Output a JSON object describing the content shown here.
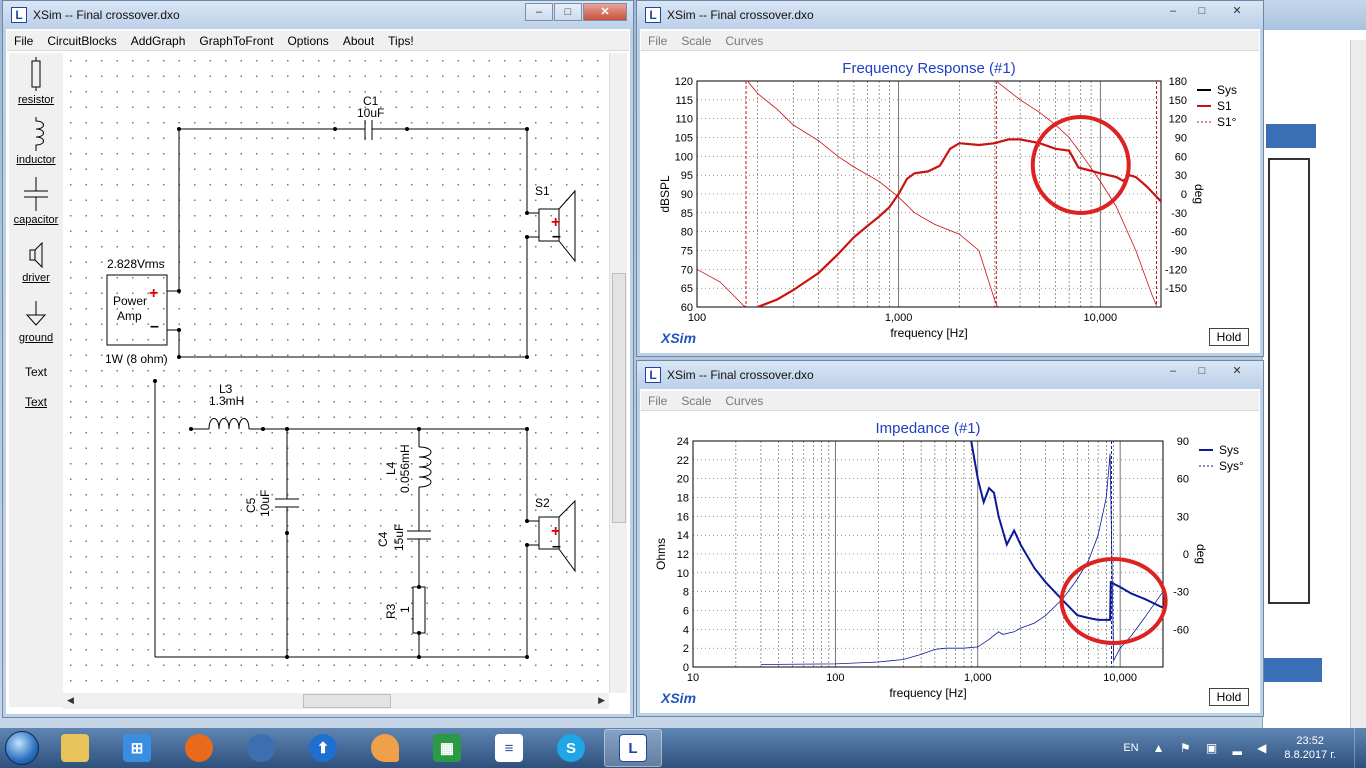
{
  "colors": {
    "sys": "#000000",
    "s1": "#cc1111",
    "imp": "#0a1a99",
    "title_blue": "#1f3fbf",
    "annot": "#dd2222"
  },
  "circuit_window": {
    "title": "XSim -- Final crossover.dxo",
    "menu": [
      "File",
      "CircuitBlocks",
      "AddGraph",
      "GraphToFront",
      "Options",
      "About",
      "Tips!"
    ],
    "palette": [
      "resistor",
      "inductor",
      "capacitor",
      "driver",
      "ground",
      "Text",
      "Text"
    ],
    "labels": {
      "c1_name": "C1",
      "c1_val": "10uF",
      "s1": "S1",
      "s2": "S2",
      "amp_v": "2.828Vrms",
      "amp_name1": "Power",
      "amp_name2": "Amp",
      "amp_p": "1W (8 ohm)",
      "l3_name": "L3",
      "l3_val": "1.3mH",
      "c5_name": "C5",
      "c5_val": "10uF",
      "l4_name": "L4",
      "l4_val": "0.056mH",
      "c4_name": "C4",
      "c4_val": "15uF",
      "r3_name": "R3",
      "r3_val": "1"
    }
  },
  "freq_window": {
    "title": "XSim -- Final crossover.dxo",
    "menu": [
      "File",
      "Scale",
      "Curves"
    ],
    "hold": "Hold",
    "logo": "XSim"
  },
  "imp_window": {
    "title": "XSim -- Final crossover.dxo",
    "menu": [
      "File",
      "Scale",
      "Curves"
    ],
    "hold": "Hold",
    "logo": "XSim"
  },
  "chart_data": [
    {
      "type": "line",
      "title": "Frequency Response (#1)",
      "xlabel": "frequency [Hz]",
      "ylabel": "dBSPL",
      "y2label": "deg",
      "x_scale": "log",
      "xlim": [
        100,
        20000
      ],
      "ylim": [
        60,
        120
      ],
      "y2lim": [
        -180,
        180
      ],
      "xticks": [
        "100",
        "1,000",
        "10,000"
      ],
      "yticks": [
        "60",
        "65",
        "70",
        "75",
        "80",
        "85",
        "90",
        "95",
        "100",
        "105",
        "110",
        "115",
        "120"
      ],
      "y2ticks": [
        "-150",
        "-120",
        "-90",
        "-60",
        "-30",
        "0",
        "30",
        "60",
        "90",
        "120",
        "150",
        "180"
      ],
      "legend_position": "top-right",
      "series": [
        {
          "name": "Sys",
          "points": []
        },
        {
          "name": "S1",
          "axis": "left",
          "points": [
            [
              200,
              60
            ],
            [
              250,
              62
            ],
            [
              300,
              64.5
            ],
            [
              400,
              69
            ],
            [
              500,
              74
            ],
            [
              600,
              78.5
            ],
            [
              700,
              81.5
            ],
            [
              800,
              84
            ],
            [
              900,
              86.5
            ],
            [
              1000,
              90
            ],
            [
              1100,
              94
            ],
            [
              1200,
              95.5
            ],
            [
              1400,
              96
            ],
            [
              1600,
              97.5
            ],
            [
              1800,
              102
            ],
            [
              2000,
              103.5
            ],
            [
              2500,
              103
            ],
            [
              3000,
              103.5
            ],
            [
              3500,
              104.5
            ],
            [
              4000,
              104.5
            ],
            [
              5000,
              103.5
            ],
            [
              6000,
              102
            ],
            [
              7000,
              101.5
            ],
            [
              7800,
              97
            ],
            [
              8500,
              96.5
            ],
            [
              10000,
              95.5
            ],
            [
              12000,
              94.5
            ],
            [
              13000,
              93.5
            ],
            [
              14000,
              95
            ],
            [
              15000,
              94.5
            ],
            [
              17000,
              92
            ],
            [
              20000,
              88
            ]
          ]
        },
        {
          "name": "S1°",
          "axis": "right",
          "points": [
            [
              100,
              -120
            ],
            [
              130,
              -140
            ],
            [
              150,
              -160
            ],
            [
              170,
              -178
            ],
            [
              180,
              178
            ],
            [
              200,
              160
            ],
            [
              250,
              135
            ],
            [
              300,
              110
            ],
            [
              400,
              85
            ],
            [
              500,
              60
            ],
            [
              600,
              43
            ],
            [
              800,
              20
            ],
            [
              1000,
              -5
            ],
            [
              1200,
              -30
            ],
            [
              1500,
              -48
            ],
            [
              2000,
              -64
            ],
            [
              2500,
              -90
            ],
            [
              3000,
              -170
            ],
            [
              3100,
              178
            ],
            [
              4000,
              150
            ],
            [
              5000,
              130
            ],
            [
              6000,
              110
            ],
            [
              7000,
              90
            ],
            [
              8000,
              65
            ],
            [
              10000,
              20
            ],
            [
              12000,
              -20
            ],
            [
              15000,
              -90
            ],
            [
              18000,
              -160
            ],
            [
              19000,
              -178
            ]
          ]
        }
      ]
    },
    {
      "type": "line",
      "title": "Impedance (#1)",
      "xlabel": "frequency [Hz]",
      "ylabel": "Ohms",
      "y2label": "deg",
      "x_scale": "log",
      "xlim": [
        10,
        20000
      ],
      "ylim": [
        0,
        24
      ],
      "y2lim": [
        -90,
        90
      ],
      "xticks": [
        "10",
        "100",
        "1,000",
        "10,000"
      ],
      "yticks": [
        "0",
        "2",
        "4",
        "6",
        "8",
        "10",
        "12",
        "14",
        "16",
        "18",
        "20",
        "22",
        "24"
      ],
      "y2ticks": [
        "-60",
        "-30",
        "0",
        "30",
        "60",
        "90"
      ],
      "legend_position": "top-right",
      "series": [
        {
          "name": "Sys",
          "axis": "left",
          "points": [
            [
              900,
              24
            ],
            [
              1000,
              20
            ],
            [
              1100,
              17.5
            ],
            [
              1200,
              19
            ],
            [
              1300,
              18.5
            ],
            [
              1400,
              16
            ],
            [
              1600,
              13
            ],
            [
              1800,
              14.5
            ],
            [
              2000,
              13
            ],
            [
              2500,
              10.5
            ],
            [
              3000,
              9
            ],
            [
              4000,
              7
            ],
            [
              5000,
              5.5
            ],
            [
              6000,
              5.2
            ],
            [
              7000,
              5
            ],
            [
              8500,
              5
            ],
            [
              8600,
              9
            ],
            [
              10000,
              8.5
            ],
            [
              12000,
              7.8
            ],
            [
              15000,
              7.2
            ],
            [
              20000,
              6.3
            ]
          ]
        },
        {
          "name": "Sys°",
          "axis": "right",
          "points": [
            [
              30,
              -88
            ],
            [
              100,
              -87.5
            ],
            [
              200,
              -86
            ],
            [
              300,
              -84
            ],
            [
              400,
              -80
            ],
            [
              500,
              -76
            ],
            [
              600,
              -75
            ],
            [
              800,
              -75
            ],
            [
              1000,
              -74
            ],
            [
              1200,
              -68
            ],
            [
              1400,
              -62
            ],
            [
              1500,
              -64
            ],
            [
              1800,
              -62
            ],
            [
              2000,
              -59
            ],
            [
              2500,
              -55
            ],
            [
              3000,
              -49
            ],
            [
              4000,
              -35
            ],
            [
              5000,
              -20
            ],
            [
              6000,
              -5
            ],
            [
              7000,
              15
            ],
            [
              8000,
              45
            ],
            [
              8500,
              80
            ],
            [
              9000,
              -85
            ],
            [
              10000,
              -75
            ],
            [
              12000,
              -65
            ],
            [
              15000,
              -50
            ],
            [
              20000,
              -30
            ]
          ]
        }
      ]
    }
  ],
  "taskbar": {
    "lang": "EN",
    "time": "23:52",
    "date": "8.8.2017 г."
  }
}
